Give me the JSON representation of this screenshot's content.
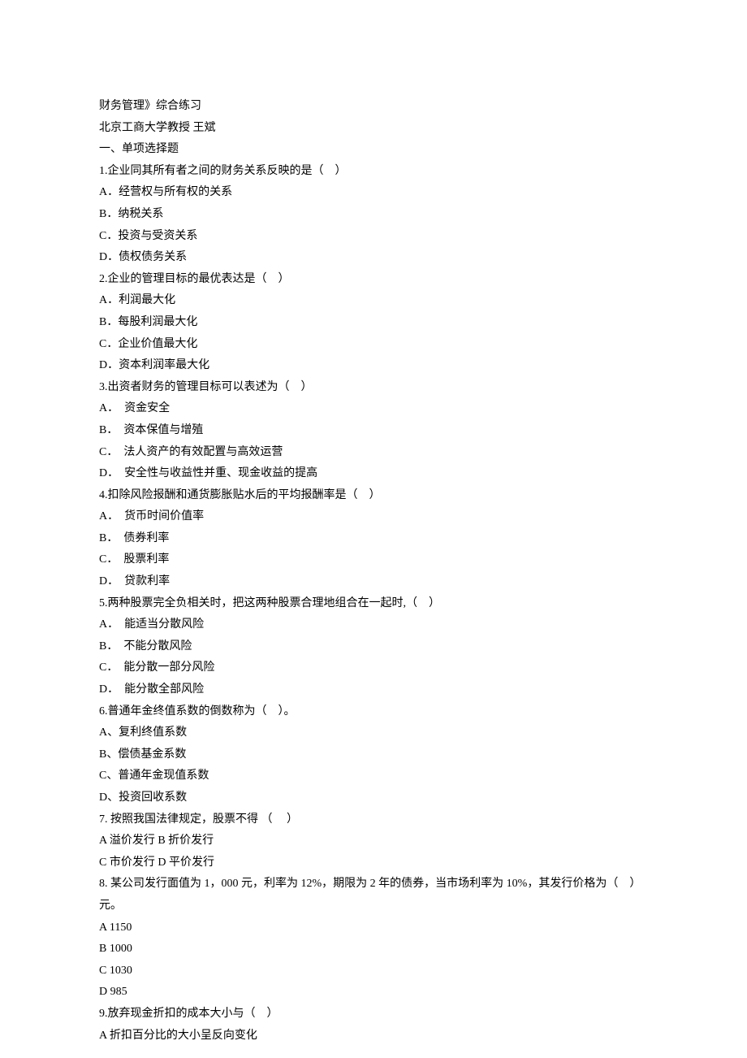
{
  "header": {
    "title": "财务管理》综合练习",
    "subtitle": "北京工商大学教授  王斌",
    "section": "一、单项选择题"
  },
  "questions": [
    {
      "stem": "1.企业同其所有者之间的财务关系反映的是（　）",
      "options": [
        "A．经营权与所有权的关系",
        "B．纳税关系",
        "C．投资与受资关系",
        "D．债权债务关系"
      ]
    },
    {
      "stem": "2.企业的管理目标的最优表达是（　）",
      "options": [
        "A．利润最大化",
        "B．每股利润最大化",
        "C．企业价值最大化",
        "D．资本利润率最大化"
      ]
    },
    {
      "stem": "3.出资者财务的管理目标可以表述为（　）",
      "options": [
        "A．　资金安全",
        "B．　资本保值与增殖",
        "C．　法人资产的有效配置与高效运营",
        "D．　安全性与收益性并重、现金收益的提高"
      ]
    },
    {
      "stem": "4.扣除风险报酬和通货膨胀贴水后的平均报酬率是（　）",
      "options": [
        "A．　货币时间价值率",
        "B．　债券利率",
        "C．　股票利率",
        "D．　贷款利率"
      ]
    },
    {
      "stem": "5.两种股票完全负相关时，把这两种股票合理地组合在一起时,（　）",
      "options": [
        "A．　能适当分散风险",
        "B．　不能分散风险",
        "C．　能分散一部分风险",
        "D．　能分散全部风险"
      ]
    },
    {
      "stem": "6.普通年金终值系数的倒数称为（　）。",
      "options": [
        "A、复利终值系数",
        "B、偿债基金系数",
        "C、普通年金现值系数",
        "D、投资回收系数"
      ]
    },
    {
      "stem": "7.  按照我国法律规定，股票不得  （　 ）",
      "options": [
        "A 溢价发行  B  折价发行",
        "C 市价发行  D  平价发行"
      ]
    },
    {
      "stem": "8.  某公司发行面值为 1，000 元，利率为 12%，期限为 2 年的债券，当市场利率为 10%，其发行价格为（　）元。",
      "options": [
        "A 1150",
        "B 1000",
        "C 1030",
        "D 985"
      ]
    },
    {
      "stem": "9.放弃现金折扣的成本大小与（　）",
      "options": [
        "A  折扣百分比的大小呈反向变化"
      ]
    }
  ]
}
